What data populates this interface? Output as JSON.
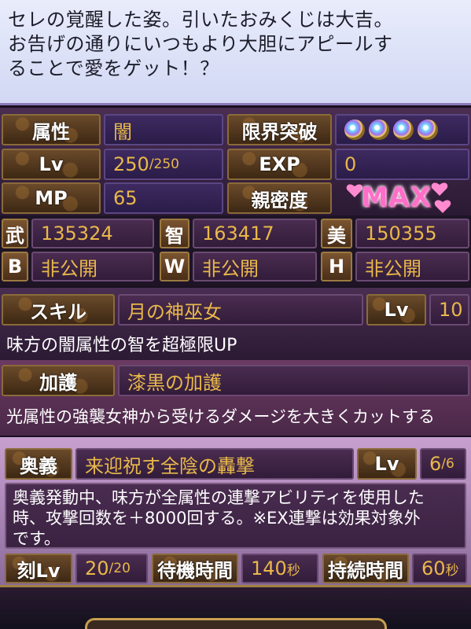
{
  "description": {
    "line1": "セレの覚醒した姿。引いたおみくじは大吉。",
    "line2": "お告げの通りにいつもより大胆にアピールす",
    "line3": "ることで愛をゲット！？"
  },
  "status": {
    "attribute_label": "属性",
    "attribute_value": "闇",
    "limit_break_label": "限界突破",
    "limit_break_gems": 4,
    "lv_label": "Lv",
    "lv_value": "250",
    "lv_max": "/250",
    "exp_label": "EXP",
    "exp_value": "0",
    "mp_label": "MP",
    "mp_value": "65",
    "affection_label": "親密度",
    "affection_value": "MAX"
  },
  "stats": {
    "bu_label": "武",
    "bu_value": "135324",
    "chi_label": "智",
    "chi_value": "163417",
    "bi_label": "美",
    "bi_value": "150355",
    "b_label": "B",
    "b_value": "非公開",
    "w_label": "W",
    "w_value": "非公開",
    "h_label": "H",
    "h_value": "非公開"
  },
  "skill": {
    "label": "スキル",
    "name": "月の神巫女",
    "lv_label": "Lv",
    "lv_value": "10",
    "description": "味方の闇属性の智を超極限UP"
  },
  "protection": {
    "label": "加護",
    "name": "漆黒の加護",
    "description": "光属性の強襲女神から受けるダメージを大きくカットする"
  },
  "ougi": {
    "label": "奥義",
    "name": "来迎祝す全陰の轟撃",
    "lv_label": "Lv",
    "lv_value": "6",
    "lv_max": "/6",
    "desc_line1": "奥義発動中、味方が全属性の連撃アビリティを使用した",
    "desc_line2": "時、攻撃回数を＋8000回する。※EX連撃は効果対象外",
    "desc_line3": "です。"
  },
  "timing": {
    "koku_label": "刻Lv",
    "koku_value": "20",
    "koku_max": "/20",
    "wait_label": "待機時間",
    "wait_value": "140",
    "wait_unit": "秒",
    "duration_label": "持続時間",
    "duration_value": "60",
    "duration_unit": "秒"
  },
  "colors": {
    "value_gold": "#e8b84a",
    "label_brown": "#5a3c20",
    "value_purple": "#3e2a60"
  }
}
